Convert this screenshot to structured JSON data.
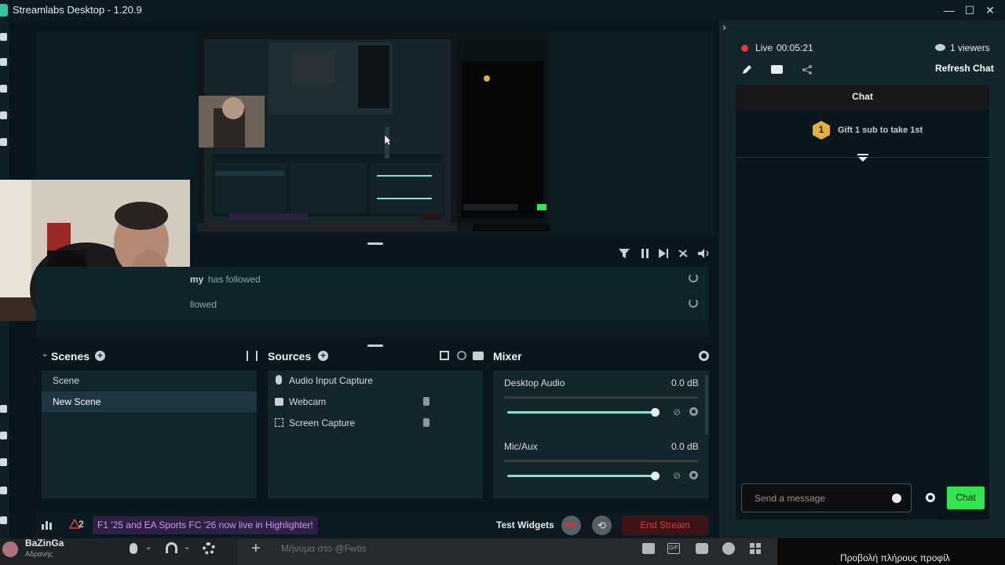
{
  "window": {
    "title": "Streamlabs Desktop - 1.20.9",
    "minimize_label": "—",
    "maximize_label": "☐",
    "close_label": "✕"
  },
  "chat_header": {
    "live_label": "Live",
    "live_time": "00:05:21",
    "viewers": "1 viewers",
    "refresh_label": "Refresh Chat"
  },
  "chat": {
    "title": "Chat",
    "gift_badge": "1",
    "gift_text": "Gift 1 sub to take 1st",
    "input_placeholder": "Send a message",
    "send_label": "Chat"
  },
  "events": {
    "items": [
      {
        "name_fragment": "my",
        "text": "has followed"
      },
      {
        "text": "llowed"
      }
    ]
  },
  "scenes": {
    "title": "Scenes",
    "items": [
      "Scene",
      "New Scene"
    ],
    "selected": "New Scene"
  },
  "sources": {
    "title": "Sources",
    "items": [
      {
        "label": "Audio Input Capture",
        "icon": "microphone-icon"
      },
      {
        "label": "Webcam",
        "icon": "webcam-icon"
      },
      {
        "label": "Screen Capture",
        "icon": "screen-capture-icon"
      }
    ]
  },
  "mixer": {
    "title": "Mixer",
    "channels": [
      {
        "label": "Desktop Audio",
        "level": "0.0 dB",
        "volume": 0.97
      },
      {
        "label": "Mic/Aux",
        "level": "0.0 dB",
        "volume": 0.97
      }
    ]
  },
  "footer": {
    "badge_count": "2",
    "promo_text": "F1 '25 and EA Sports FC '26 now live in Highlighter!",
    "test_widgets": "Test Widgets",
    "rec_label": "REC",
    "end_stream": "End Stream"
  },
  "discord": {
    "username": "BaZinGa",
    "status": "Αδρανής",
    "message_placeholder": "Μήνυμα στο @Fwtis",
    "view_profile": "Προβολή πλήρους προφίλ"
  },
  "colors": {
    "accent": "#31c3a2",
    "live_red": "#e0393e",
    "chat_green": "#31e34f",
    "promo_purple": "#c79bf8"
  }
}
